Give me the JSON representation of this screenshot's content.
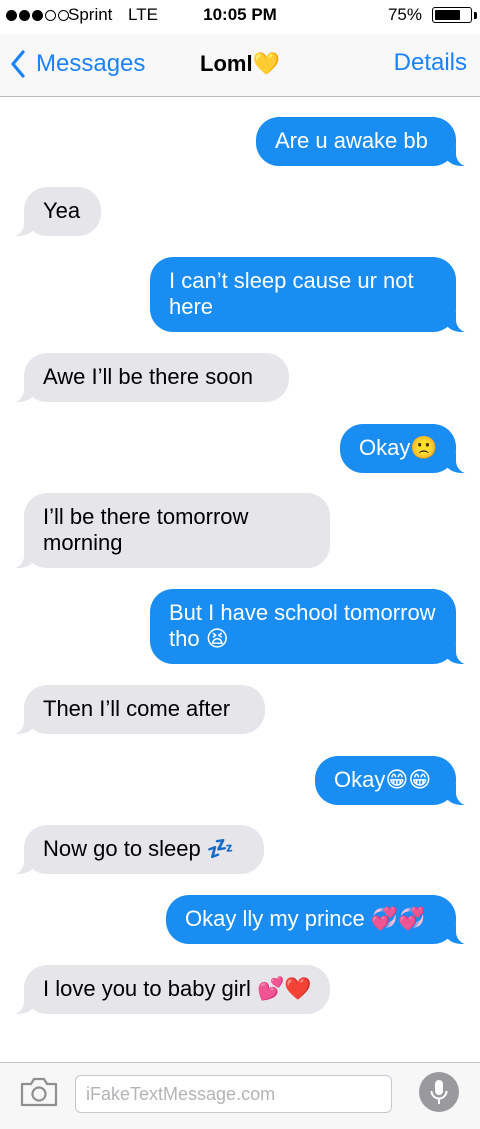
{
  "status_bar": {
    "carrier": "Sprint",
    "network": "LTE",
    "time": "10:05 PM",
    "battery": "75%",
    "battery_level": 0.75,
    "signal_bars": 3,
    "signal_total": 5
  },
  "nav": {
    "back_label": "Messages",
    "title": "Loml💛",
    "details_label": "Details"
  },
  "messages": [
    {
      "side": "sent",
      "text": "Are u awake bb"
    },
    {
      "side": "received",
      "text": "Yea"
    },
    {
      "side": "sent",
      "text": "I can’t sleep cause ur not here"
    },
    {
      "side": "received",
      "text": "Awe I’ll be there soon"
    },
    {
      "side": "sent",
      "text": "Okay🙁"
    },
    {
      "side": "received",
      "text": "I’ll be there tomorrow morning"
    },
    {
      "side": "sent",
      "text": "But I have school tomorrow tho 😫"
    },
    {
      "side": "received",
      "text": "Then I’ll come after"
    },
    {
      "side": "sent",
      "text": "Okay😁😁"
    },
    {
      "side": "received",
      "text": "Now go to sleep 💤"
    },
    {
      "side": "sent",
      "text": "Okay lly my prince 💞💞"
    },
    {
      "side": "received",
      "text": "I love you to baby girl 💕❤️"
    }
  ],
  "input": {
    "placeholder": "iFakeTextMessage.com"
  },
  "colors": {
    "sent_bubble": "#1a8df3",
    "received_bubble": "#e5e5ea",
    "accent": "#1a82fb"
  },
  "icons": {
    "back": "chevron-left-icon",
    "camera": "camera-icon",
    "mic": "microphone-icon"
  }
}
